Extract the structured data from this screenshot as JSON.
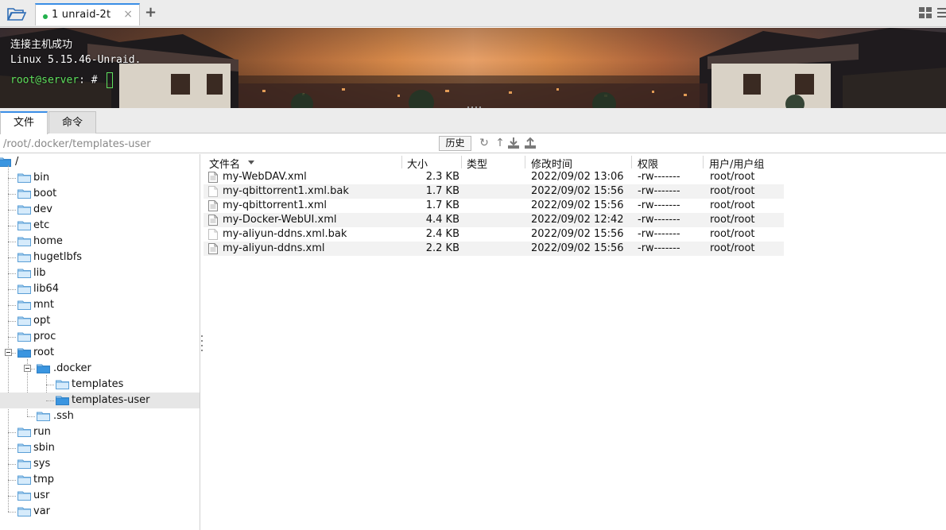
{
  "window": {
    "tab_label": "1 unraid-2t",
    "tab_close": "×",
    "add_tab": "+"
  },
  "terminal": {
    "line1": "连接主机成功",
    "line2": "Linux 5.15.46-Unraid.",
    "prompt_user": "root@server",
    "prompt_rest": ": # "
  },
  "subtabs": [
    "文件",
    "命令"
  ],
  "pathbar": {
    "path": "/root/.docker/templates-user",
    "history_label": "历史",
    "icons": [
      "refresh-icon",
      "up-icon",
      "download-icon",
      "upload-icon"
    ]
  },
  "tree": {
    "root_label": "/",
    "items": [
      "bin",
      "boot",
      "dev",
      "etc",
      "home",
      "hugetlbfs",
      "lib",
      "lib64",
      "mnt",
      "opt",
      "proc",
      "root",
      ".docker",
      "templates",
      "templates-user",
      ".ssh",
      "run",
      "sbin",
      "sys",
      "tmp",
      "usr",
      "var"
    ],
    "selected": "templates-user"
  },
  "file_list": {
    "columns": [
      "文件名",
      "大小",
      "类型",
      "修改时间",
      "权限",
      "用户/用户组"
    ],
    "rows": [
      {
        "name": "my-WebDAV.xml",
        "size": "2.3 KB",
        "type": "",
        "mtime": "2022/09/02 13:06",
        "perm": "-rw-------",
        "owner": "root/root"
      },
      {
        "name": "my-qbittorrent1.xml.bak",
        "size": "1.7 KB",
        "type": "",
        "mtime": "2022/09/02 15:56",
        "perm": "-rw-------",
        "owner": "root/root"
      },
      {
        "name": "my-qbittorrent1.xml",
        "size": "1.7 KB",
        "type": "",
        "mtime": "2022/09/02 15:56",
        "perm": "-rw-------",
        "owner": "root/root"
      },
      {
        "name": "my-Docker-WebUI.xml",
        "size": "4.4 KB",
        "type": "",
        "mtime": "2022/09/02 12:42",
        "perm": "-rw-------",
        "owner": "root/root"
      },
      {
        "name": "my-aliyun-ddns.xml.bak",
        "size": "2.4 KB",
        "type": "",
        "mtime": "2022/09/02 15:56",
        "perm": "-rw-------",
        "owner": "root/root"
      },
      {
        "name": "my-aliyun-ddns.xml",
        "size": "2.2 KB",
        "type": "",
        "mtime": "2022/09/02 15:56",
        "perm": "-rw-------",
        "owner": "root/root"
      }
    ]
  },
  "colors": {
    "accent": "#3a8ee6",
    "prompt_green": "#5ee05e",
    "folder_blue": "#4aa3e8"
  }
}
